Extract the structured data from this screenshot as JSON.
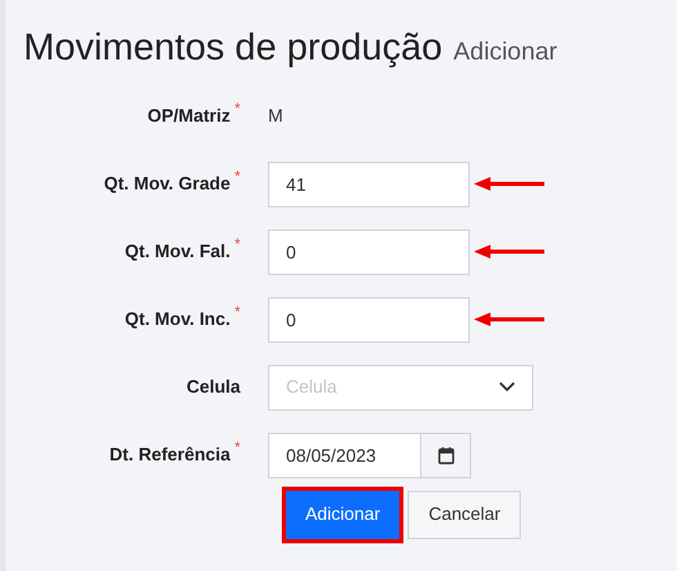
{
  "header": {
    "title": "Movimentos de produção",
    "subtitle": "Adicionar"
  },
  "fields": [
    {
      "kind": "static",
      "label": "OP/Matriz",
      "required_mark": "*",
      "value": "M",
      "arrow": false
    },
    {
      "kind": "input",
      "label": "Qt. Mov. Grade",
      "required_mark": "*",
      "value": "41",
      "arrow": true
    },
    {
      "kind": "input",
      "label": "Qt. Mov. Fal.",
      "required_mark": "*",
      "value": "0",
      "arrow": true
    },
    {
      "kind": "input",
      "label": "Qt. Mov. Inc.",
      "required_mark": "*",
      "value": "0",
      "arrow": true
    },
    {
      "kind": "select",
      "label": "Celula",
      "placeholder": "Celula",
      "arrow": false
    },
    {
      "kind": "date",
      "label": "Dt. Referência",
      "required_mark": "*",
      "value": "08/05/2023",
      "arrow": false
    }
  ],
  "buttons": [
    {
      "label": "Adicionar",
      "kind": "primary",
      "highlighted": true
    },
    {
      "label": "Cancelar",
      "kind": "secondary",
      "highlighted": false
    }
  ]
}
